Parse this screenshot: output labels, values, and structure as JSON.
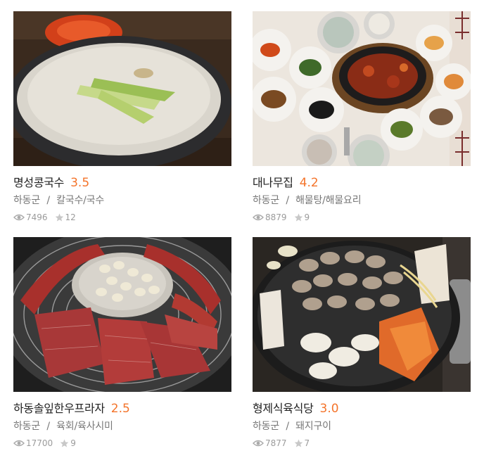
{
  "restaurants": [
    {
      "name": "명성콩국수",
      "score": "3.5",
      "region": "하동군",
      "separator": "/",
      "category": "칼국수/국수",
      "views": "7496",
      "favorites": "12",
      "photo": "bowl-noodle-soup"
    },
    {
      "name": "대나무집",
      "score": "4.2",
      "region": "하동군",
      "separator": "/",
      "category": "해물탕/해물요리",
      "views": "8879",
      "favorites": "9",
      "photo": "sizzling-plate-side-dishes"
    },
    {
      "name": "하동솔잎한우프라자",
      "score": "2.5",
      "region": "하동군",
      "separator": "/",
      "category": "육회/육사시미",
      "views": "17700",
      "favorites": "9",
      "photo": "grilled-beef-garlic"
    },
    {
      "name": "형제식육식당",
      "score": "3.0",
      "region": "하동군",
      "separator": "/",
      "category": "돼지구이",
      "views": "7877",
      "favorites": "7",
      "photo": "grilled-pork-kimchi"
    }
  ]
}
